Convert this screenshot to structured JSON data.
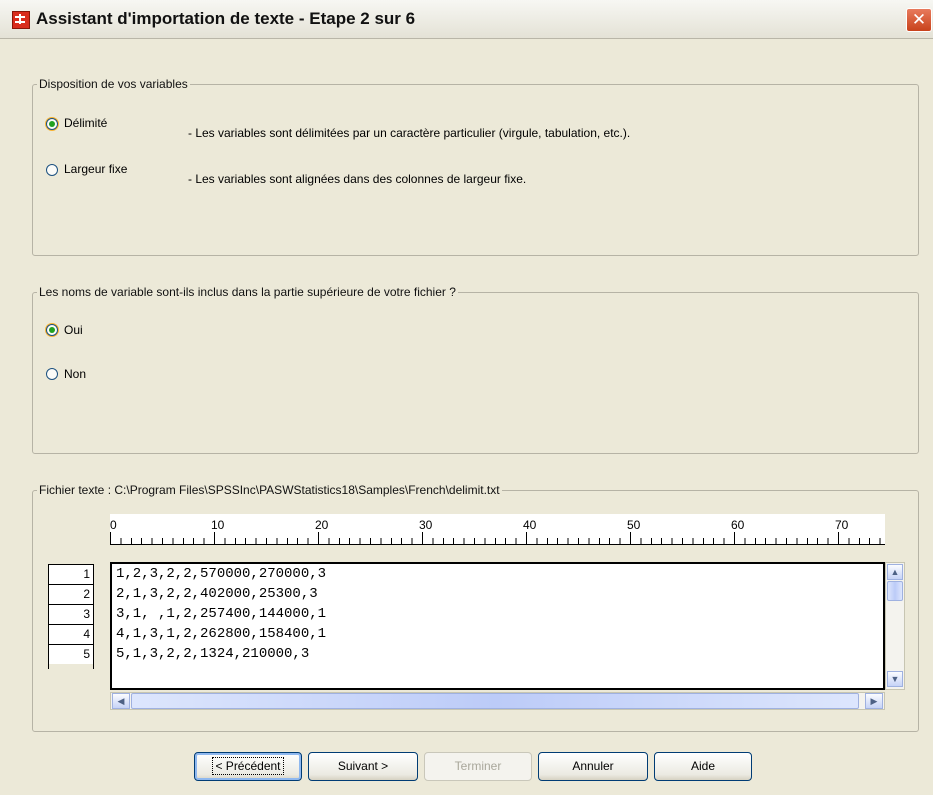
{
  "window": {
    "title": "Assistant d'importation de texte - Etape 2 sur 6",
    "close_glyph": "✕"
  },
  "layout_group": {
    "legend": "Disposition de vos variables",
    "options": [
      {
        "label": "Délimité",
        "selected": true,
        "description": "- Les variables sont délimitées par un caractère particulier (virgule, tabulation, etc.)."
      },
      {
        "label": "Largeur fixe",
        "selected": false,
        "description": "- Les variables sont alignées dans des colonnes de largeur fixe."
      }
    ]
  },
  "names_group": {
    "legend": "Les noms de variable sont-ils inclus dans la partie supérieure de votre fichier ?",
    "options": [
      {
        "label": "Oui",
        "selected": true
      },
      {
        "label": "Non",
        "selected": false
      }
    ]
  },
  "file_group": {
    "legend": "Fichier texte :  C:\\Program Files\\SPSSInc\\PASWStatistics18\\Samples\\French\\delimit.txt",
    "ruler_labels": [
      "0",
      "10",
      "20",
      "30",
      "40",
      "50",
      "60",
      "70"
    ],
    "row_numbers": [
      "1",
      "2",
      "3",
      "4",
      "5"
    ],
    "lines": [
      "1,2,3,2,2,570000,270000,3",
      "2,1,3,2,2,402000,25300,3",
      "3,1, ,1,2,257400,144000,1",
      "4,1,3,1,2,262800,158400,1",
      "5,1,3,2,2,1324,210000,3"
    ]
  },
  "buttons": {
    "back": "< Précédent",
    "next": "Suivant >",
    "finish": "Terminer",
    "cancel": "Annuler",
    "help": "Aide"
  },
  "colors": {
    "dialog_bg": "#ece9d8",
    "radio_selected": "#21a121",
    "title_icon": "#d92c1c",
    "close_button": "#c8421b"
  },
  "icons": [
    "spreadsheet-app-icon",
    "close-icon",
    "scroll-up-icon",
    "scroll-down-icon",
    "scroll-left-icon",
    "scroll-right-icon"
  ]
}
